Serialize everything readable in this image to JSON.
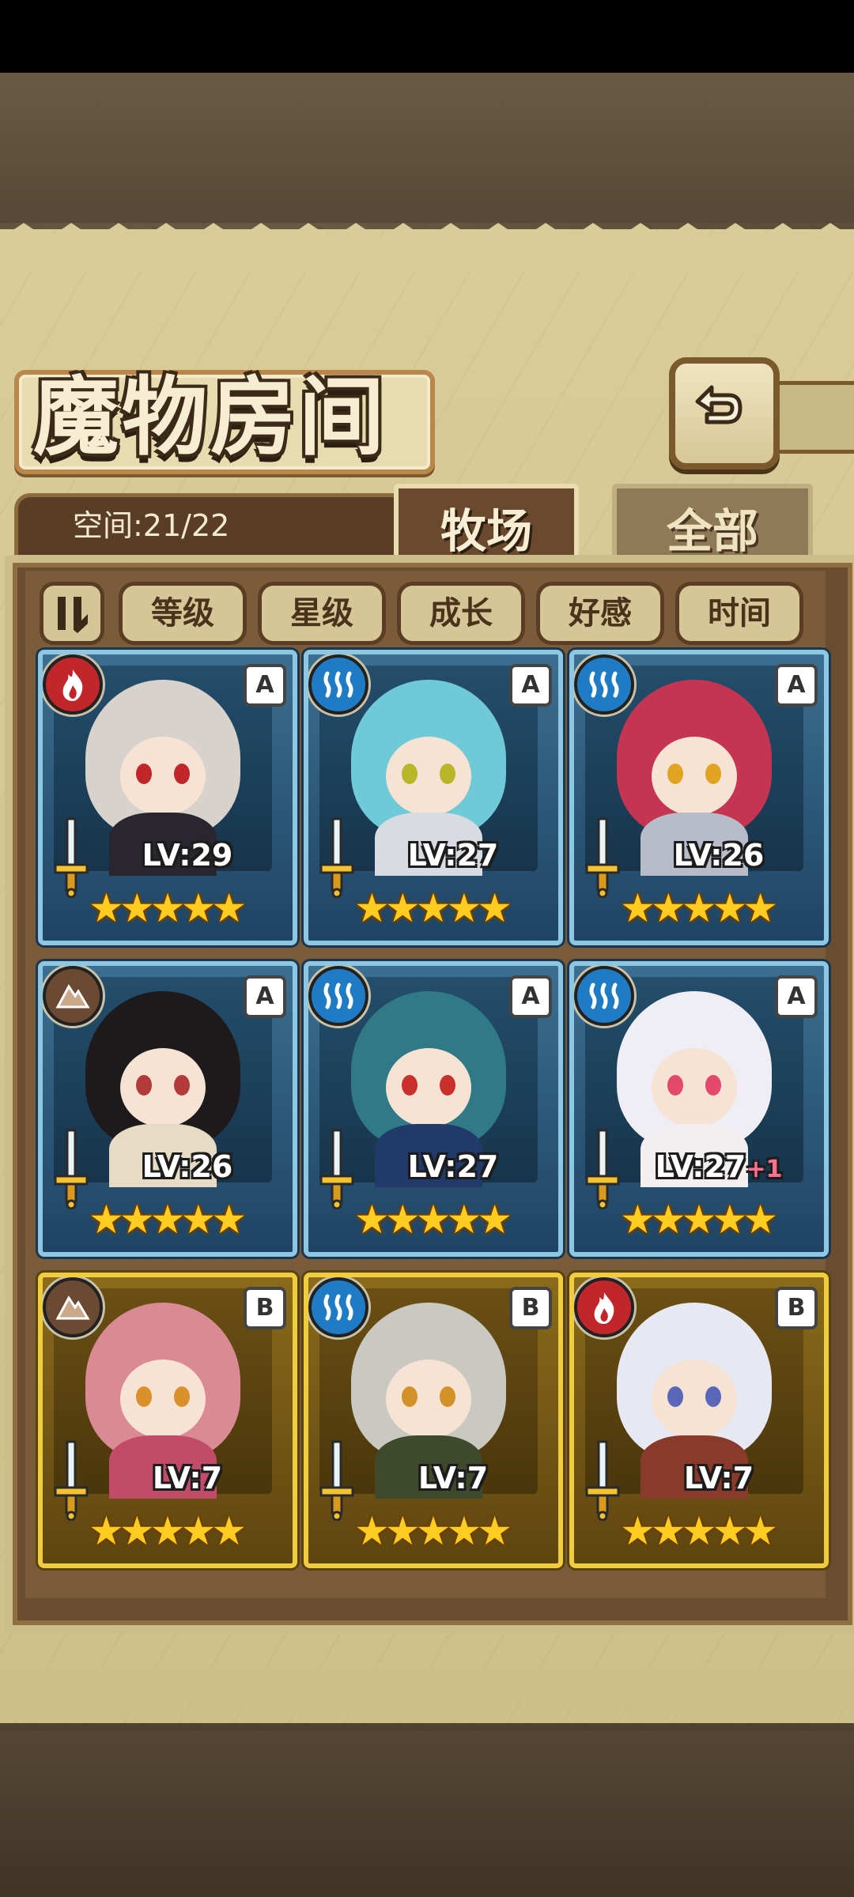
{
  "header": {
    "title": "魔物房间"
  },
  "capacity": {
    "label": "空间:21/22"
  },
  "tabs": [
    {
      "label": "牧场",
      "active": true
    },
    {
      "label": "全部",
      "active": false
    }
  ],
  "sort_buttons": [
    "等级",
    "星级",
    "成长",
    "好感",
    "时间"
  ],
  "element_icons": {
    "fire": "flame-icon",
    "water": "water-waves-icon",
    "earth": "mountain-icon"
  },
  "colors": {
    "tier_a_border": "#8ec7e2",
    "tier_b_border": "#f0cd3e",
    "fire": "#c1262a",
    "water": "#1f7cc4",
    "earth": "#6a4a33"
  },
  "monsters": [
    {
      "element": "fire",
      "rank": "A",
      "level": "LV:29",
      "bonus": "",
      "stars": 5,
      "hair": "#d8d2cc",
      "eyes": "#c0262a",
      "outfit": "#2a2630"
    },
    {
      "element": "water",
      "rank": "A",
      "level": "LV:27",
      "bonus": "",
      "stars": 5,
      "hair": "#6fc9d6",
      "eyes": "#b9b62a",
      "outfit": "#d9dbe3"
    },
    {
      "element": "water",
      "rank": "A",
      "level": "LV:26",
      "bonus": "",
      "stars": 5,
      "hair": "#c53552",
      "eyes": "#e0a322",
      "outfit": "#b8bcc8"
    },
    {
      "element": "earth",
      "rank": "A",
      "level": "LV:26",
      "bonus": "",
      "stars": 5,
      "hair": "#1e1a1c",
      "eyes": "#b23a3a",
      "outfit": "#e6dbc4"
    },
    {
      "element": "water",
      "rank": "A",
      "level": "LV:27",
      "bonus": "",
      "stars": 5,
      "hair": "#2f7a86",
      "eyes": "#c9302c",
      "outfit": "#223a6a"
    },
    {
      "element": "water",
      "rank": "A",
      "level": "LV:27",
      "bonus": "+1",
      "stars": 5,
      "hair": "#eeeef4",
      "eyes": "#e4486a",
      "outfit": "#f3eef0"
    },
    {
      "element": "earth",
      "rank": "B",
      "level": "LV:7",
      "bonus": "",
      "stars": 5,
      "hair": "#d98a92",
      "eyes": "#d9902a",
      "outfit": "#c24b6a"
    },
    {
      "element": "water",
      "rank": "B",
      "level": "LV:7",
      "bonus": "",
      "stars": 5,
      "hair": "#c9c9c2",
      "eyes": "#d3912a",
      "outfit": "#3f4a2c"
    },
    {
      "element": "fire",
      "rank": "B",
      "level": "LV:7",
      "bonus": "",
      "stars": 5,
      "hair": "#e6e8f2",
      "eyes": "#5a66b8",
      "outfit": "#8a3a2a"
    }
  ]
}
